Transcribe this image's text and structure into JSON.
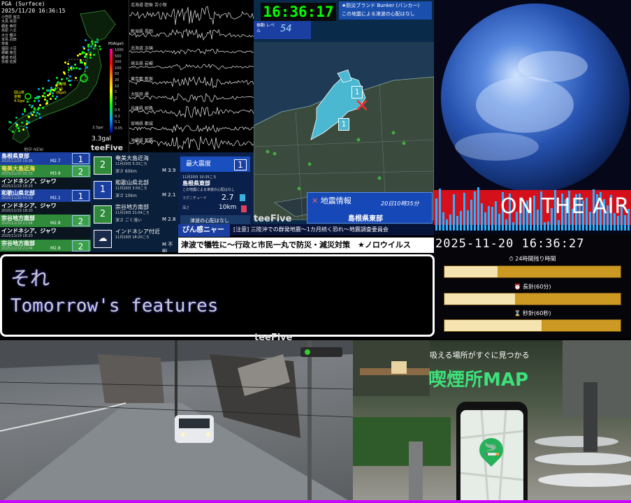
{
  "quake_map": {
    "header_lines": [
      "PGA (Surface)",
      "2025/11/20 16:36:15"
    ],
    "stats_lines": [
      "小笠原 宮古",
      "大島 出羽",
      "網走 西村",
      "島原 八丈",
      "大分 種子",
      "本島 羽田",
      "奈良",
      "福岡 小豆",
      "那覇 宮古",
      "都城 石垣",
      "島根 佐賀"
    ],
    "scale_title": "PGA(gal)",
    "scale_ticks": [
      "1000",
      "500",
      "200",
      "100",
      "50",
      "20",
      "10",
      "5",
      "2",
      "1",
      "0.5",
      "0.2",
      "0.1",
      "0.05"
    ],
    "labels": [
      "岡山県",
      "倉敷",
      "4.5gal"
    ],
    "labels2": [
      "山梨県",
      "小山",
      "(8gal)"
    ],
    "small_value": "3.3gal",
    "big_value": "3.3gal",
    "now_new": "地中 NEW",
    "brand": "teeFive"
  },
  "seismograms": {
    "stations": [
      "北海道 胆振 苫小牧",
      "新潟県 長岡",
      "北海道 浜頓",
      "埼玉県 岩槻",
      "東京都 新宿",
      "大阪府 堺",
      "兵庫県 姫路",
      "宮崎県 都城",
      "沖縄県 那覇"
    ]
  },
  "tsunami_panel": {
    "clock": "16:36:17",
    "bunker_lines": [
      "★防災ブランド Bunker (バンカー)",
      "この地震による津波の心配はなし"
    ],
    "level_label": "振動 レベル",
    "level_value": "54",
    "shindo_tags": [
      "1",
      "1"
    ],
    "info_title": "地震情報",
    "info_time": "20日10時35分",
    "info_area": "島根県東部",
    "brand": "teeFive",
    "epicenter": "✕"
  },
  "earth_panel": {
    "banner": "ON THE AIR",
    "accent": "#d6101a"
  },
  "quake_list": [
    {
      "title": "島根県東部",
      "time": "2025/11/20 10:35",
      "mag": "M2.7",
      "shindo": "1",
      "color": "#1a3fa0",
      "text_color": "#fff"
    },
    {
      "title": "奄美大島近海",
      "time": "2025/11/20 05:33",
      "mag": "M3.9",
      "shindo": "2",
      "color": "#2f8a3a",
      "text_color": "#ffe35a"
    },
    {
      "title": "インドネシア、ジャワ",
      "time": "2025/11/19 18:20",
      "mag": "",
      "shindo": "",
      "color": "#0a1520",
      "text_color": "#fff"
    },
    {
      "title": "和歌山県北部",
      "time": "2025/11/20 03:50",
      "mag": "M2.1",
      "shindo": "1",
      "color": "#1a3fa0",
      "text_color": "#fff"
    },
    {
      "title": "インドネシア、ジャワ",
      "time": "2025/11/19 18:20",
      "mag": "",
      "shindo": "",
      "color": "#0a1520",
      "text_color": "#fff"
    },
    {
      "title": "宗谷地方南部",
      "time": "2025/11/19 21:04",
      "mag": "M2.8",
      "shindo": "2",
      "color": "#2f8a3a",
      "text_color": "#fff"
    },
    {
      "title": "インドネシア、ジャワ",
      "time": "2025/11/19 18:20",
      "mag": "",
      "shindo": "",
      "color": "#0a1520",
      "text_color": "#fff"
    },
    {
      "title": "宗谷地方南部",
      "time": "2025/11/19 21:04",
      "mag": "M2.8",
      "shindo": "2",
      "color": "#2f8a3a",
      "text_color": "#fff"
    }
  ],
  "detail_cards": [
    {
      "badge": "2",
      "area": "奄美大島近海",
      "time": "11月20日 5:33ころ",
      "depth": "深さ 60km",
      "mag": "M 3.9",
      "color": "#2f8a3a"
    },
    {
      "badge": "1",
      "area": "和歌山県北部",
      "time": "11月20日 3:50ころ",
      "depth": "深さ 10km",
      "mag": "M 2.1",
      "color": "#1a3fa0"
    },
    {
      "badge": "2",
      "area": "宗谷地方南部",
      "time": "11月19日 21:04ころ",
      "depth": "深さ ごく浅い",
      "mag": "M 2.8",
      "color": "#2f8a3a"
    },
    {
      "badge": "☁",
      "area": "インドネシア付近",
      "time": "11月19日 18:20ころ",
      "depth": "",
      "mag": "M 不明",
      "color": "#1a2a4a"
    }
  ],
  "max_panel": {
    "title": "最大震度",
    "value": "1",
    "time": "11月20日 10:35ころ",
    "area": "島根県東部",
    "tsunami": "この地震による津波の心配はなし",
    "mag_label": "マグニチュード",
    "mag_value": "2.7",
    "depth_label": "深さ",
    "depth_value": "10km",
    "tsunami_box": "津波の心配はなし"
  },
  "tickers": {
    "pinkan": "ぴん感ニャース",
    "notice": "[注意] 三陸沖での群発地震〜1カ月続く恐れ〜地震調査委員会",
    "news": "津波で犠牲に〜行政と市民一丸で防災・減災対策　★ノロウイルス"
  },
  "time_panel": {
    "datetime": "2025-11-20 16:36:27",
    "bars": [
      {
        "label": "⏱ 24時間残り時間",
        "fraction": 0.3
      },
      {
        "label": "⏰ 長針(60分)",
        "fraction": 0.4
      },
      {
        "label": "⌛ 秒針(60秒)",
        "fraction": 0.55
      }
    ]
  },
  "subtitle": {
    "line1": "それ",
    "line2": "Tomorrow's features"
  },
  "camera": {
    "brand": "teeFive"
  },
  "ad": {
    "subtitle": "吸える場所がすぐに見つかる",
    "title": "喫煙所MAP",
    "pin_icon": "🚬"
  }
}
